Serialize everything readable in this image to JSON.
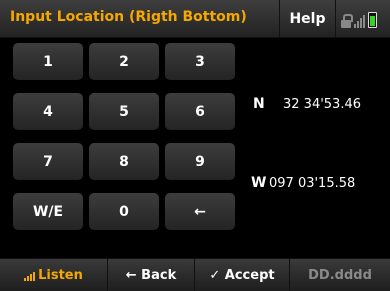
{
  "header": {
    "title": "Input Location (Rigth Bottom)",
    "help_label": "Help"
  },
  "keypad": {
    "keys": [
      "1",
      "2",
      "3",
      "4",
      "5",
      "6",
      "7",
      "8",
      "9",
      "W/E",
      "0",
      "←"
    ]
  },
  "coordinates": {
    "lat_dir": "N",
    "lat_value": "32 34'53.46",
    "lon_dir": "W",
    "lon_value": "097 03'15.58"
  },
  "footer": {
    "listen_label": "Listen",
    "back_label": "← Back",
    "accept_label": "✓ Accept",
    "format_label": "DD.dddd"
  },
  "colors": {
    "accent": "#f5a800",
    "battery": "#3bd12a",
    "disabled_text": "#8a8a8a"
  }
}
